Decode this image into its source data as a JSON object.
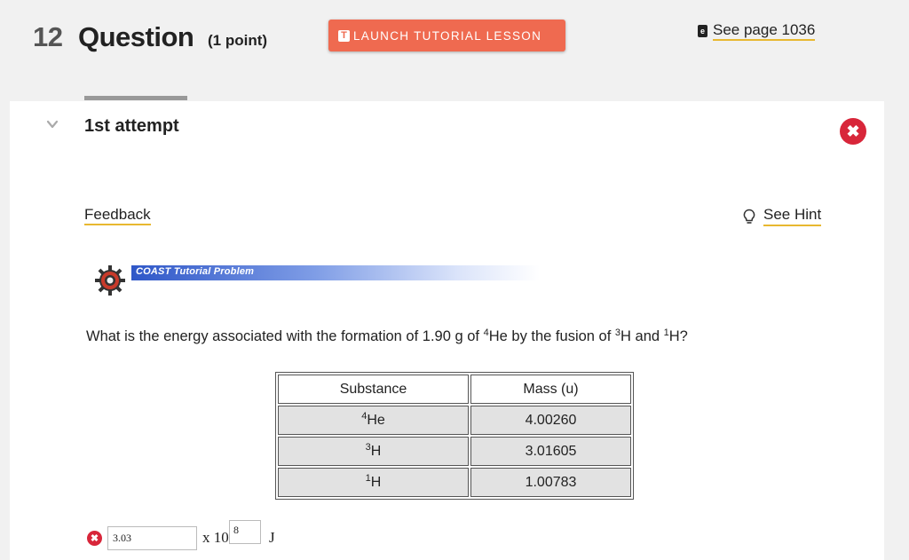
{
  "header": {
    "question_number": "12",
    "question_word": "Question",
    "points": "(1 point)",
    "launch_label": "LAUNCH TUTORIAL LESSON",
    "launch_icon_letter": "T",
    "see_page": "See page 1036"
  },
  "attempt": {
    "label": "1st attempt",
    "status_icon": "x-circle-icon",
    "status_color": "#d8263a"
  },
  "links": {
    "feedback": "Feedback",
    "hint": "See Hint"
  },
  "banner": {
    "text": "COAST Tutorial Problem"
  },
  "question": {
    "prefix": "What is the energy associated with the formation of 1.90 g of ",
    "he_mass": "4",
    "he": "He by the fusion of ",
    "h3_mass": "3",
    "h3": "H and ",
    "h1_mass": "1",
    "h1": "H?"
  },
  "table": {
    "headers": [
      "Substance",
      "Mass (u)"
    ],
    "rows": [
      {
        "sup": "4",
        "symbol": "He",
        "mass": "4.00260"
      },
      {
        "sup": "3",
        "symbol": "H",
        "mass": "3.01605"
      },
      {
        "sup": "1",
        "symbol": "H",
        "mass": "1.00783"
      }
    ]
  },
  "answer": {
    "value": "3.03",
    "times": "x 10",
    "exponent": "8",
    "unit": "J",
    "status_icon": "x-circle-icon"
  },
  "colors": {
    "accent": "#ef6a50",
    "underline": "#e8b830",
    "error": "#d8263a",
    "banner_blue": "#2f57c8"
  }
}
